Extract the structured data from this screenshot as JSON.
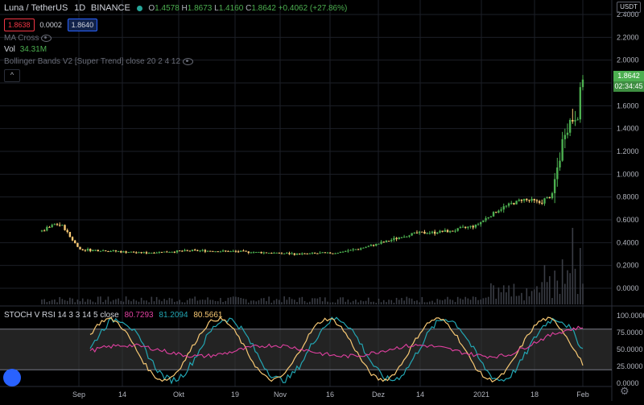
{
  "header": {
    "symbol": "Luna / TetherUS",
    "interval": "1D",
    "exchange": "BINANCE",
    "open_label": "O",
    "open": "1.4578",
    "high_label": "H",
    "high": "1.8673",
    "low_label": "L",
    "low": "1.4160",
    "close_label": "C",
    "close": "1.8642",
    "change": "+0.4062 (+27.86%)",
    "bid": "1.8638",
    "spread": "0.0002",
    "ask": "1.8640"
  },
  "indicators": {
    "ma": "MA Cross",
    "vol_label": "Vol",
    "vol_value": "34.31M",
    "bb": "Bollinger Bands V2 [Super Trend] close 20 2 4 12"
  },
  "price_axis": {
    "currency": "USDT",
    "ticks": [
      "2.4000",
      "2.2000",
      "2.0000",
      "1.8000",
      "1.6000",
      "1.4000",
      "1.2000",
      "1.0000",
      "0.8000",
      "0.6000",
      "0.4000",
      "0.2000",
      "0.0000"
    ],
    "last_price": "1.8642",
    "countdown": "02:34:45"
  },
  "stoch": {
    "title": "STOCH V RSI 14 3 3 14 5 close",
    "v1": "80.7293",
    "v2": "81.2094",
    "v3": "80.5661",
    "ticks": [
      "100.0000",
      "75.0000",
      "50.0000",
      "25.0000",
      "0.0000"
    ]
  },
  "time_axis": {
    "labels": [
      "Sep",
      "14",
      "Okt",
      "19",
      "Nov",
      "16",
      "Dez",
      "14",
      "2021",
      "18",
      "Feb"
    ]
  },
  "colors": {
    "up": "#4caf50",
    "down": "#f7c873",
    "bb": "#26a69a",
    "stoch_k": "#f7c873",
    "stoch_d": "#22a6b3",
    "rsi": "#e040a0",
    "bid": "#f23645",
    "ask": "#2962ff"
  },
  "chart_data": {
    "type": "candlestick",
    "series": [
      {
        "name": "Luna / TetherUS",
        "x_range": [
          "Aug 2020",
          "Feb 2021"
        ],
        "close_points": [
          [
            0,
            0.5
          ],
          [
            5,
            0.56
          ],
          [
            8,
            0.55
          ],
          [
            11,
            0.45
          ],
          [
            15,
            0.34
          ],
          [
            25,
            0.33
          ],
          [
            40,
            0.31
          ],
          [
            60,
            0.33
          ],
          [
            80,
            0.32
          ],
          [
            100,
            0.3
          ],
          [
            115,
            0.31
          ],
          [
            125,
            0.35
          ],
          [
            135,
            0.41
          ],
          [
            145,
            0.48
          ],
          [
            160,
            0.5
          ],
          [
            170,
            0.55
          ],
          [
            180,
            0.7
          ],
          [
            188,
            0.78
          ],
          [
            195,
            0.75
          ],
          [
            200,
            0.82
          ],
          [
            205,
            1.4
          ],
          [
            210,
            1.55
          ],
          [
            212,
            1.8642
          ]
        ]
      }
    ],
    "stoch_lines": [
      "K",
      "D",
      "RSI"
    ],
    "ylim": [
      0,
      2.4
    ]
  }
}
